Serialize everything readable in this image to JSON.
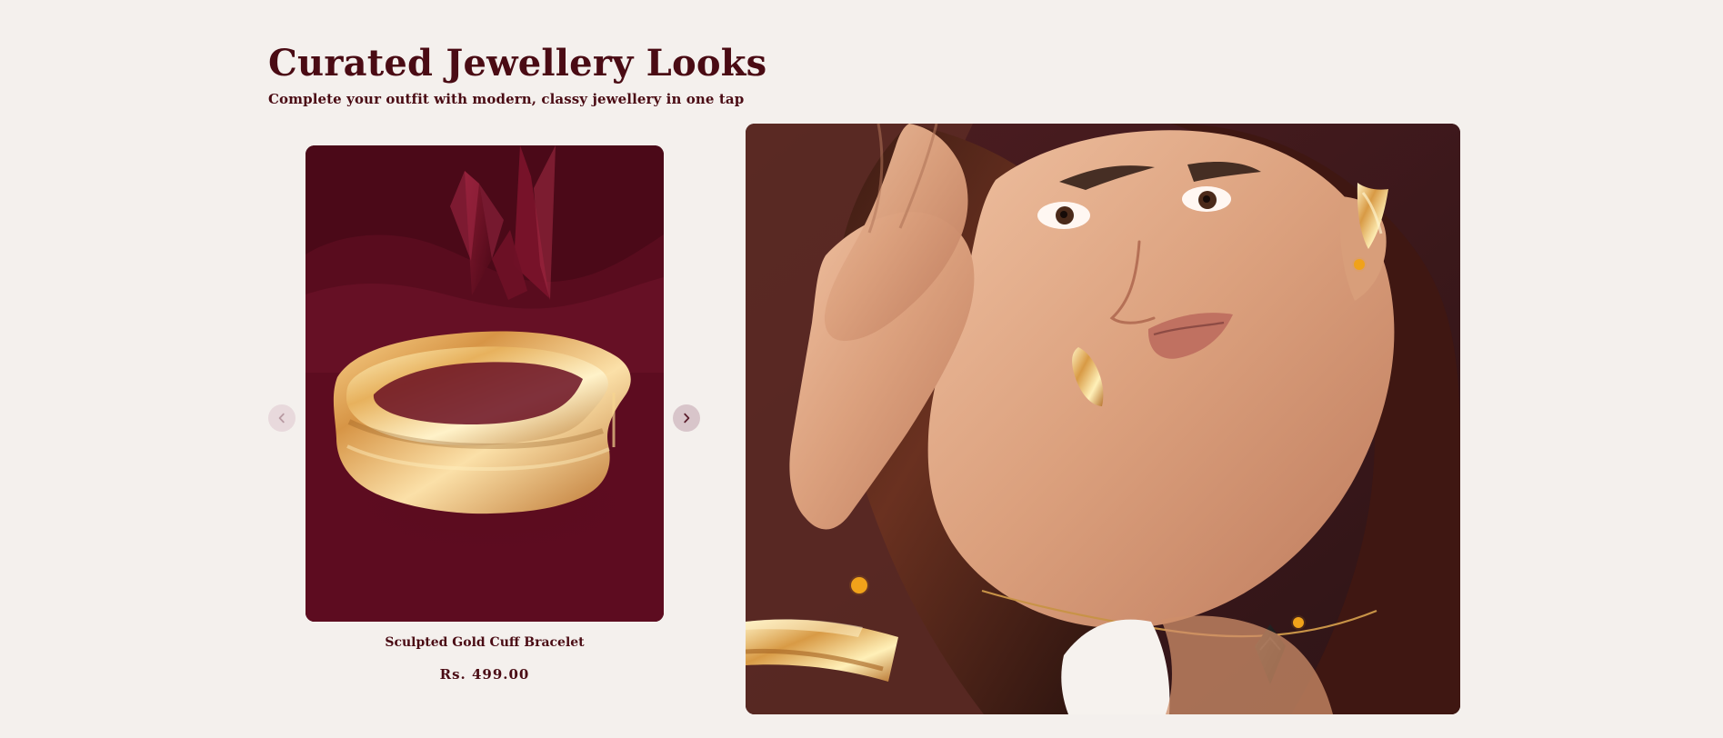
{
  "section": {
    "title": "Curated Jewellery Looks",
    "subtitle": "Complete your outfit with modern, classy jewellery in one tap"
  },
  "carousel": {
    "product": {
      "name": "Sculpted Gold Cuff Bracelet",
      "price": "Rs. 499.00",
      "image_subject": "gold cuff bracelet on burgundy backdrop"
    },
    "navigation": {
      "prev_icon": "chevron-left-icon",
      "next_icon": "chevron-right-icon"
    }
  },
  "look_image": {
    "subject": "model wearing gold earrings, bracelet and pendant necklace",
    "hotspots": [
      {
        "name": "earring-hotspot"
      },
      {
        "name": "bracelet-hotspot"
      },
      {
        "name": "necklace-hotspot"
      }
    ]
  },
  "colors": {
    "background": "#f4f0ed",
    "brand_text": "#4a0b14",
    "hotspot": "#f0a21a",
    "nav_button": "#d8c5ca"
  }
}
